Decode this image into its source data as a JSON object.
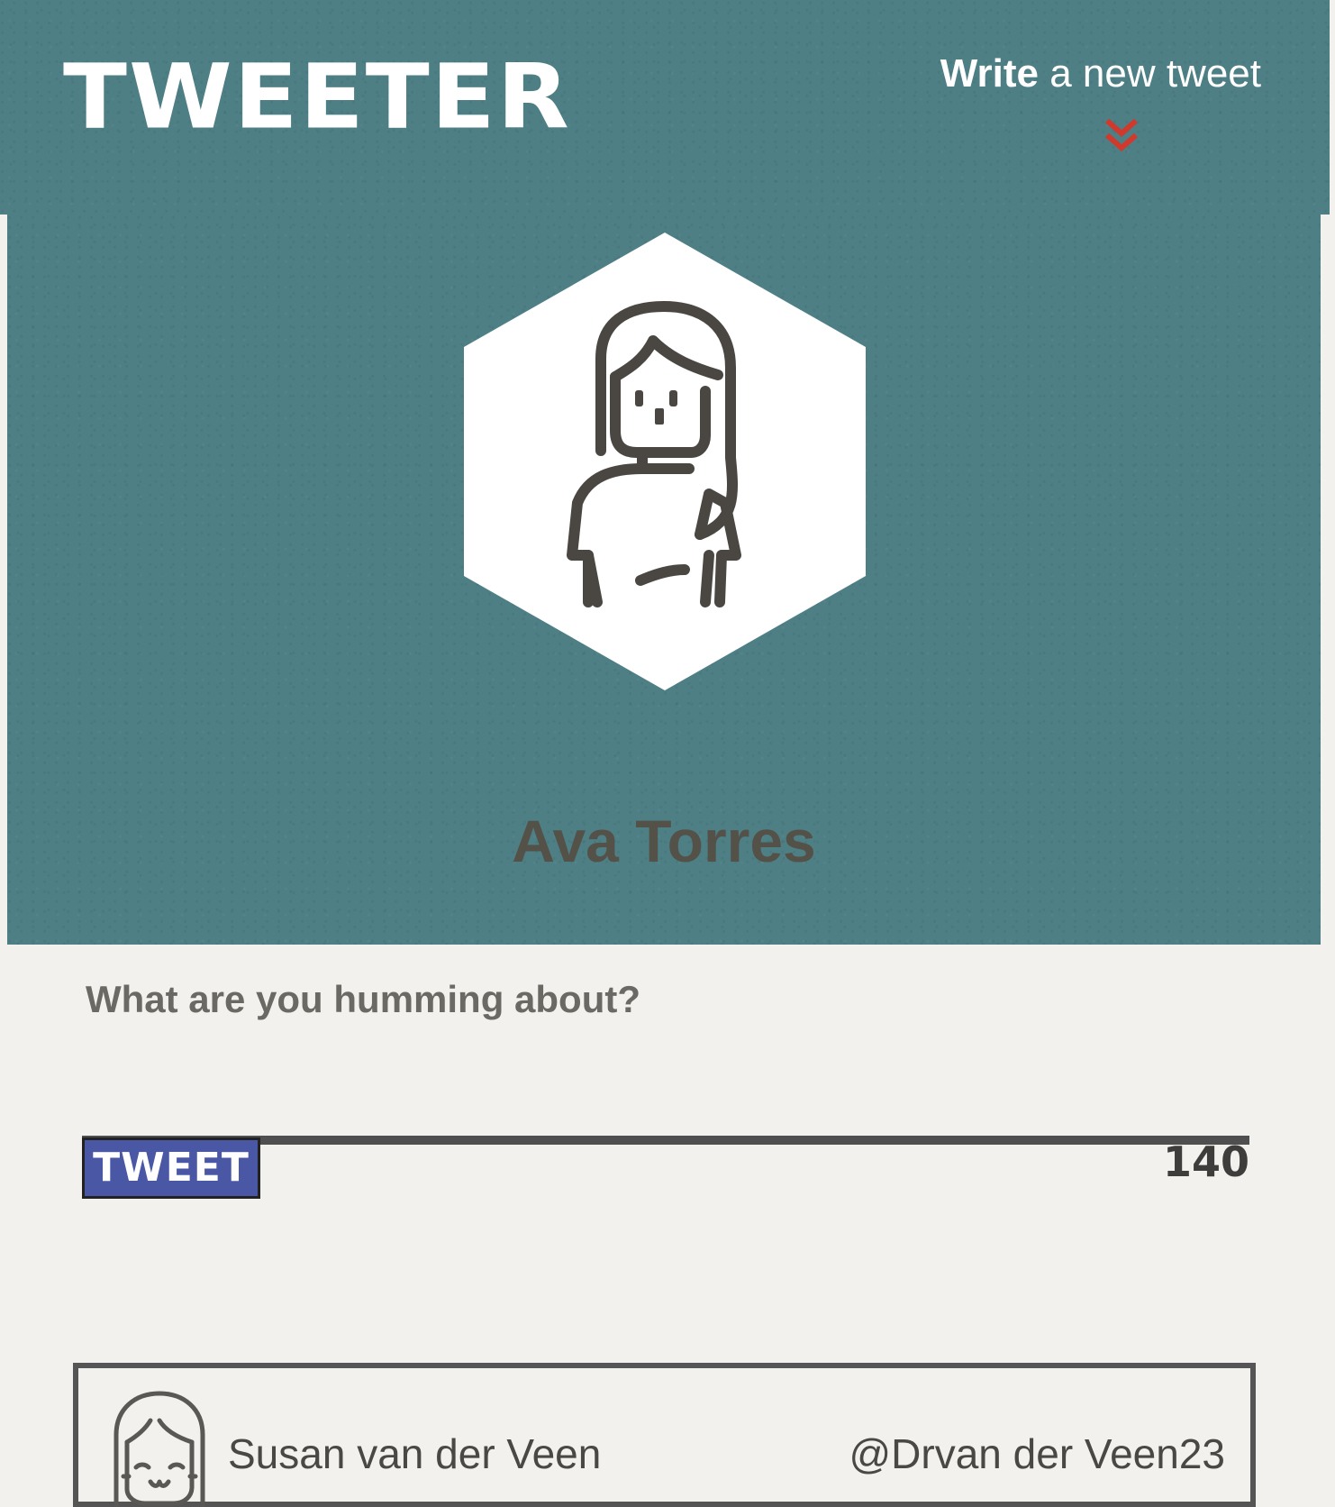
{
  "header": {
    "brand": "TWEETER",
    "compose_toggle": {
      "strong": "Write",
      "rest": " a new tweet",
      "icon": "double-chevron-down-icon",
      "icon_color": "#d0392b"
    }
  },
  "profile": {
    "name": "Ava Torres",
    "avatar_icon": "woman-avatar-icon"
  },
  "composer": {
    "prompt": "What are you humming about?",
    "textarea_value": "",
    "submit_label": "TWEET",
    "counter": "140"
  },
  "tweets": [
    {
      "avatar_icon": "smiling-face-avatar-icon",
      "name": "Susan van der Veen",
      "handle": "@Drvan der Veen23"
    }
  ],
  "colors": {
    "accent_teal": "#4d7f85",
    "button_blue": "#4a57a5",
    "page_bg": "#f2f1ed",
    "chevron_red": "#d0392b"
  }
}
